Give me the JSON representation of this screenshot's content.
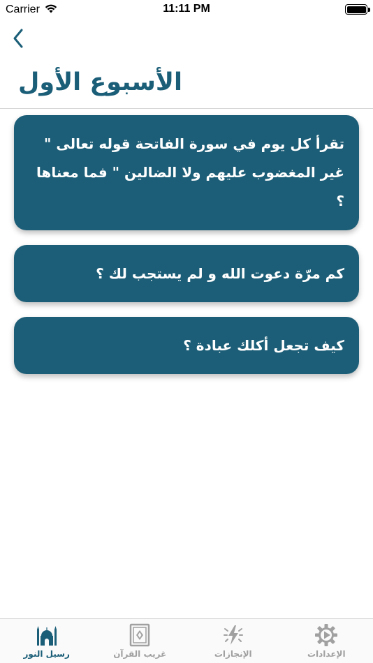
{
  "status_bar": {
    "carrier": "Carrier",
    "time": "11:11 PM",
    "battery_level": 1.0
  },
  "nav": {
    "back_icon": "chevron-left-icon",
    "title": "الأسبوع الأول"
  },
  "questions": [
    {
      "text": "تقرأ كل يوم في سورة الفاتحة قوله تعالى \" غير المغضوب عليهم ولا الضالين \" فما معناها ؟"
    },
    {
      "text": "كم مرّة دعوت الله و لم يستجب لك ؟"
    },
    {
      "text": "كيف تجعل أكلك عبادة ؟"
    }
  ],
  "tab_bar": {
    "active_index": 0,
    "active_color": "#1b5e78",
    "inactive_color": "#a0a0a0",
    "tabs": [
      {
        "label": "رسيل النور",
        "icon": "mosque-icon"
      },
      {
        "label": "غريب القرآن",
        "icon": "quran-book-icon"
      },
      {
        "label": "الإنجازات",
        "icon": "lightning-icon"
      },
      {
        "label": "الإعدادات",
        "icon": "gear-icon"
      }
    ]
  },
  "colors": {
    "accent": "#1b5e78",
    "card_background": "#1c5e77",
    "card_text": "#ffffff"
  }
}
